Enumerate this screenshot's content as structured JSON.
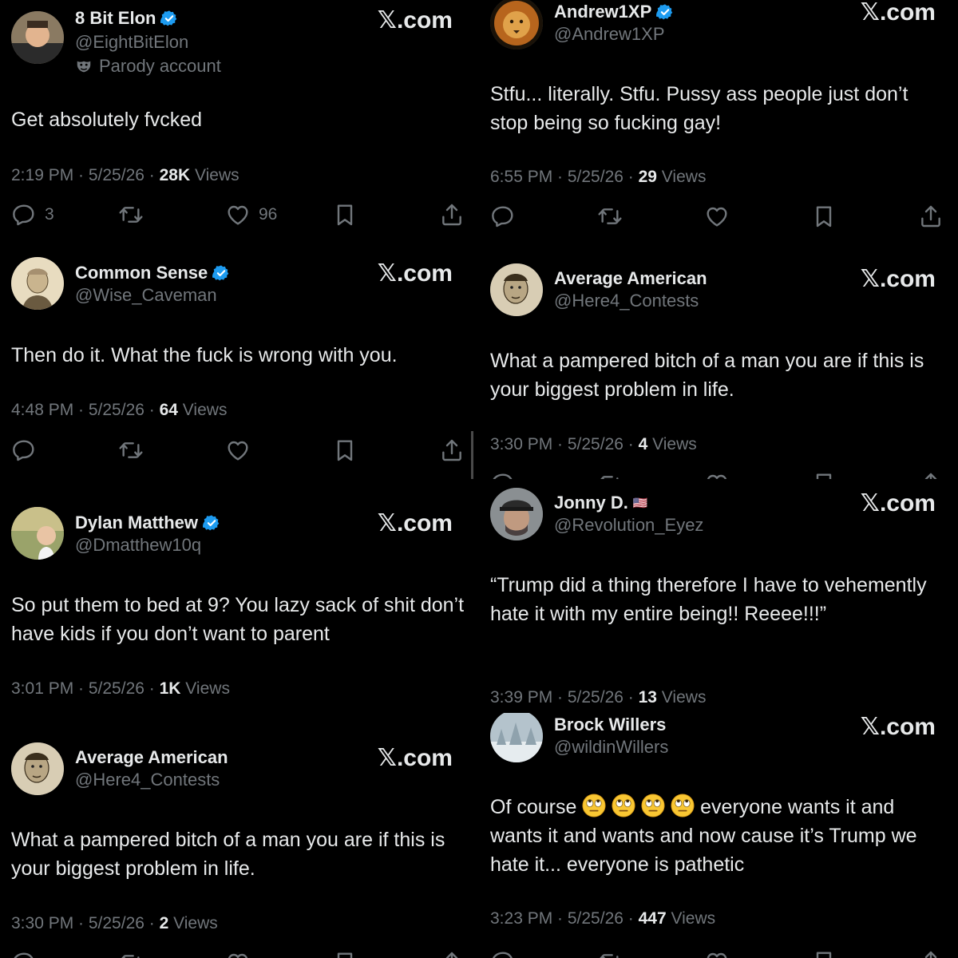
{
  "brand": "𝕏.com",
  "tweets": [
    {
      "name": "8 Bit Elon",
      "handle": "@EightBitElon",
      "parody": "Parody account",
      "text": "Get absolutely fvcked",
      "time": "2:19 PM · 5/25/26 · ",
      "views": "28K",
      "views_label": " Views",
      "replies": "3",
      "likes": "96",
      "verified": true
    },
    {
      "name": "Andrew1XP",
      "handle": "@Andrew1XP",
      "text": "Stfu... literally. Stfu. Pussy ass people just don’t stop being so fucking gay!",
      "time": "6:55 PM · 5/25/26 · ",
      "views": "29",
      "views_label": " Views",
      "verified": true
    },
    {
      "name": "Common Sense",
      "handle": "@Wise_Caveman",
      "text": "Then do it. What the fuck is wrong with you.",
      "time": "4:48 PM · 5/25/26 · ",
      "views": "64",
      "views_label": " Views",
      "verified": true
    },
    {
      "name": "Average American",
      "handle": "@Here4_Contests",
      "text": "What a pampered bitch of a man you are if this is your biggest problem in life.",
      "time": "3:30 PM · 5/25/26 · ",
      "views": "4",
      "views_label": " Views",
      "verified": false
    },
    {
      "name": "Dylan Matthew",
      "handle": "@Dmatthew10q",
      "text": "So put them to bed at 9? You lazy sack of shit don’t have kids if you don’t want to parent",
      "time": "3:01 PM · 5/25/26 · ",
      "views": "1K",
      "views_label": " Views",
      "verified": true
    },
    {
      "name": "Jonny D.",
      "flag": "🇺🇸",
      "handle": "@Revolution_Eyez",
      "text": "“Trump did a thing therefore I have to vehemently hate it with my entire being!! Reeee!!!”",
      "time": "3:39 PM · 5/25/26 · ",
      "views": "13",
      "views_label": " Views",
      "verified": false
    },
    {
      "name": "Average American",
      "handle": "@Here4_Contests",
      "text": "What a pampered bitch of a man you are if this is your biggest problem in life.",
      "time": "3:30 PM · 5/25/26 · ",
      "views": "2",
      "views_label": " Views",
      "verified": false
    },
    {
      "name": "Brock Willers",
      "handle": "@wildinWillers",
      "text_before": "Of course ",
      "text_after": " everyone wants it and wants it and wants and now cause it’s Trump we hate it... everyone is pathetic",
      "emoji": "face-with-rolling-eyes",
      "time": "3:23 PM · 5/25/26 · ",
      "views": "447",
      "views_label": " Views",
      "verified": false
    }
  ],
  "icons": {
    "reply": "reply-icon",
    "repost": "repost-icon",
    "like": "like-icon",
    "bookmark": "bookmark-icon",
    "share": "share-icon",
    "verified": "verified-badge-icon"
  },
  "colors": {
    "background": "#000000",
    "text": "#e7e9ea",
    "muted": "#71767b",
    "verified": "#1d9bf0"
  }
}
